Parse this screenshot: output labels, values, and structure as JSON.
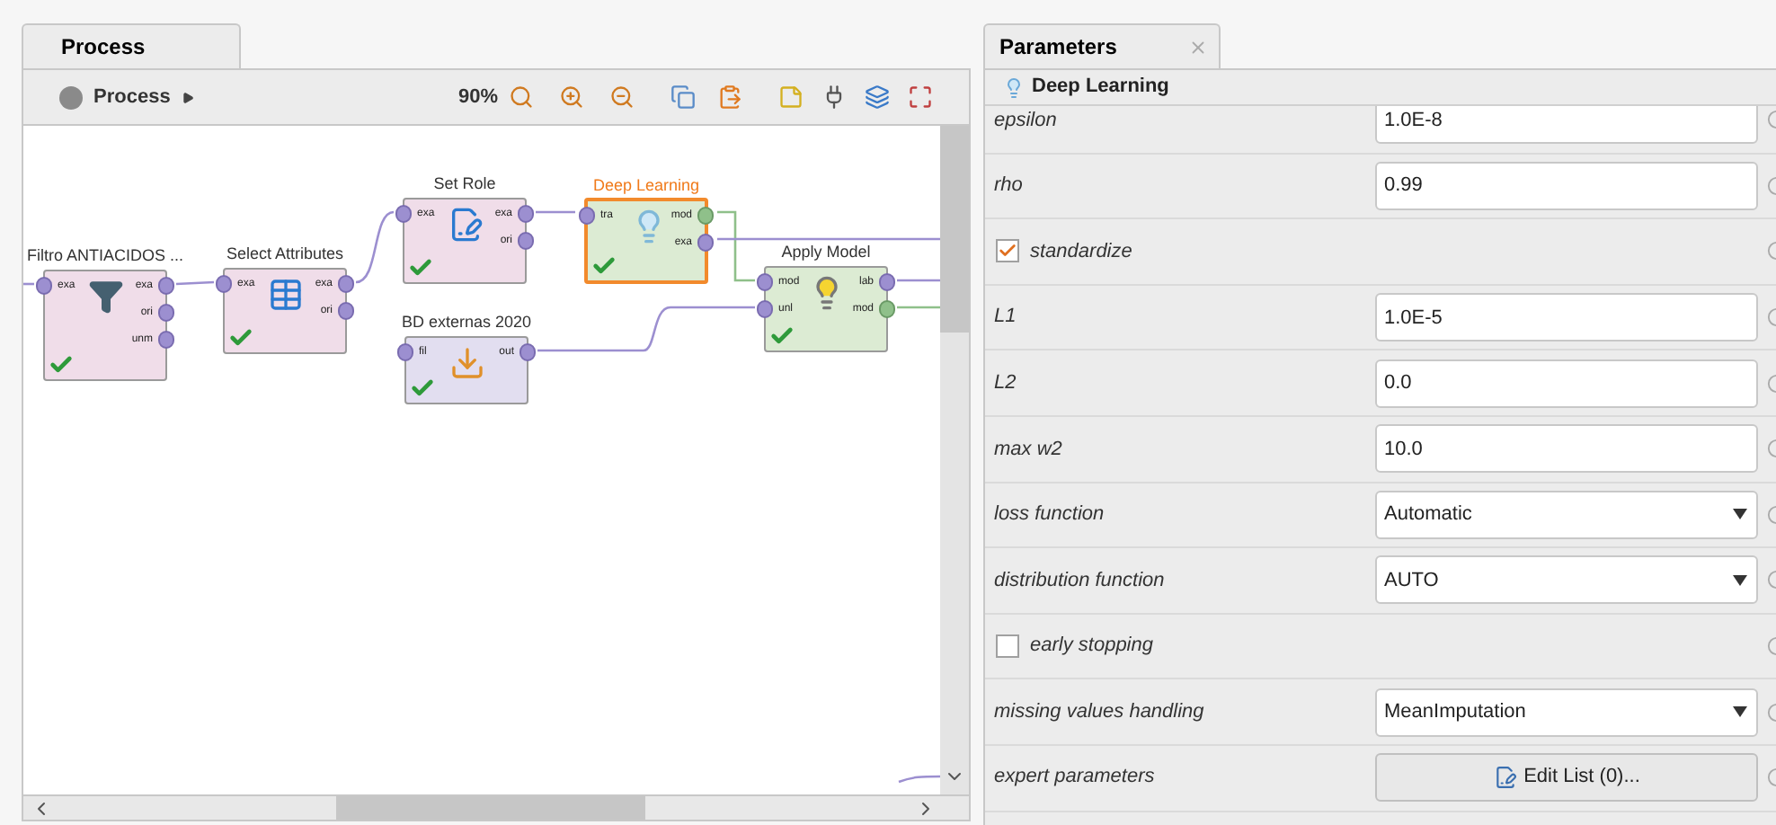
{
  "process_panel": {
    "tab": {
      "label": "Process",
      "selected": true
    },
    "breadcrumb": "Process",
    "zoom": "90%",
    "nodes": [
      {
        "title": "Filtro ANTIACIDOS ...",
        "kind": "filter",
        "color": "#f0dde9",
        "selected": false,
        "ok": true,
        "inputs": [
          "exa"
        ],
        "outputs": [
          "exa",
          "ori",
          "unm"
        ]
      },
      {
        "title": "Select Attributes",
        "kind": "table",
        "color": "#f0dde9",
        "selected": false,
        "ok": true,
        "inputs": [
          "exa"
        ],
        "outputs": [
          "exa",
          "ori"
        ]
      },
      {
        "title": "Set Role",
        "kind": "edit",
        "color": "#f0dde9",
        "selected": false,
        "ok": true,
        "inputs": [
          "exa"
        ],
        "outputs": [
          "exa",
          "ori"
        ]
      },
      {
        "title": "Deep Learning",
        "kind": "model",
        "color": "#dcebd3",
        "selected": true,
        "ok": true,
        "inputs": [
          "tra"
        ],
        "outputs": [
          "mod",
          "exa"
        ]
      },
      {
        "title": "BD externas 2020",
        "kind": "import",
        "color": "#e2def0",
        "selected": false,
        "ok": true,
        "inputs": [
          "fil"
        ],
        "outputs": [
          "out"
        ]
      },
      {
        "title": "Apply Model",
        "kind": "apply",
        "color": "#dcebd3",
        "selected": false,
        "ok": true,
        "inputs": [
          "mod",
          "unl"
        ],
        "outputs": [
          "lab",
          "mod"
        ]
      }
    ]
  },
  "parameters_panel": {
    "tab": {
      "label": "Parameters",
      "selected": true
    },
    "operator": "Deep Learning",
    "rows": [
      {
        "kind": "text",
        "label": "epsilon",
        "value": "1.0E-8"
      },
      {
        "kind": "text",
        "label": "rho",
        "value": "0.99"
      },
      {
        "kind": "check",
        "label": "standardize",
        "checked": true
      },
      {
        "kind": "text",
        "label": "L1",
        "value": "1.0E-5"
      },
      {
        "kind": "text",
        "label": "L2",
        "value": "0.0"
      },
      {
        "kind": "text",
        "label": "max w2",
        "value": "10.0"
      },
      {
        "kind": "select",
        "label": "loss function",
        "value": "Automatic"
      },
      {
        "kind": "select",
        "label": "distribution function",
        "value": "AUTO"
      },
      {
        "kind": "check",
        "label": "early stopping",
        "checked": false
      },
      {
        "kind": "select",
        "label": "missing values handling",
        "value": "MeanImputation"
      },
      {
        "kind": "button",
        "label": "expert parameters",
        "value": "Edit List (0)..."
      }
    ]
  }
}
